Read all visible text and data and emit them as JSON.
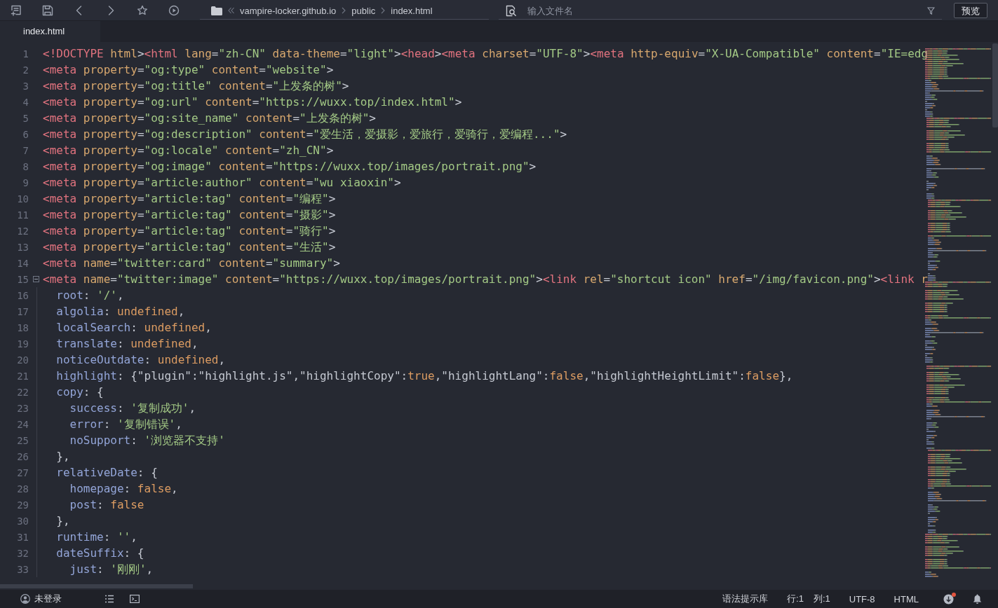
{
  "toolbar": {
    "breadcrumb": [
      "vampire-locker.github.io",
      "public",
      "index.html"
    ],
    "file_search": {
      "placeholder": "输入文件名"
    },
    "preview_button": "预览"
  },
  "tabs": [
    {
      "label": "index.html",
      "selected": true
    }
  ],
  "editor": {
    "lines": [
      {
        "number": "1",
        "fold": false,
        "tokens": [
          {
            "kind": "tag",
            "text": "<!DOCTYPE"
          },
          {
            "kind": "at",
            "text": " html"
          },
          {
            "kind": "p",
            "text": ">"
          },
          {
            "kind": "tag",
            "text": "<html"
          },
          {
            "kind": "at",
            "text": " lang"
          },
          {
            "kind": "p",
            "text": "="
          },
          {
            "kind": "s",
            "text": "\"zh-CN\""
          },
          {
            "kind": "at",
            "text": " data-theme"
          },
          {
            "kind": "p",
            "text": "="
          },
          {
            "kind": "s",
            "text": "\"light\""
          },
          {
            "kind": "p",
            "text": ">"
          },
          {
            "kind": "tag",
            "text": "<head"
          },
          {
            "kind": "p",
            "text": ">"
          },
          {
            "kind": "tag",
            "text": "<meta"
          },
          {
            "kind": "at",
            "text": " charset"
          },
          {
            "kind": "p",
            "text": "="
          },
          {
            "kind": "s",
            "text": "\"UTF-8\""
          },
          {
            "kind": "p",
            "text": ">"
          },
          {
            "kind": "tag",
            "text": "<meta"
          },
          {
            "kind": "at",
            "text": " http-equiv"
          },
          {
            "kind": "p",
            "text": "="
          },
          {
            "kind": "s",
            "text": "\"X-UA-Compatible\""
          },
          {
            "kind": "at",
            "text": " content"
          },
          {
            "kind": "p",
            "text": "="
          },
          {
            "kind": "s",
            "text": "\"IE=edg"
          }
        ]
      },
      {
        "number": "2",
        "fold": false,
        "tokens": [
          {
            "kind": "tag",
            "text": "<meta"
          },
          {
            "kind": "at",
            "text": " property"
          },
          {
            "kind": "p",
            "text": "="
          },
          {
            "kind": "s",
            "text": "\"og:type\""
          },
          {
            "kind": "at",
            "text": " content"
          },
          {
            "kind": "p",
            "text": "="
          },
          {
            "kind": "s",
            "text": "\"website\""
          },
          {
            "kind": "p",
            "text": ">"
          }
        ]
      },
      {
        "number": "3",
        "fold": false,
        "tokens": [
          {
            "kind": "tag",
            "text": "<meta"
          },
          {
            "kind": "at",
            "text": " property"
          },
          {
            "kind": "p",
            "text": "="
          },
          {
            "kind": "s",
            "text": "\"og:title\""
          },
          {
            "kind": "at",
            "text": " content"
          },
          {
            "kind": "p",
            "text": "="
          },
          {
            "kind": "s",
            "text": "\"上发条的树\""
          },
          {
            "kind": "p",
            "text": ">"
          }
        ]
      },
      {
        "number": "4",
        "fold": false,
        "tokens": [
          {
            "kind": "tag",
            "text": "<meta"
          },
          {
            "kind": "at",
            "text": " property"
          },
          {
            "kind": "p",
            "text": "="
          },
          {
            "kind": "s",
            "text": "\"og:url\""
          },
          {
            "kind": "at",
            "text": " content"
          },
          {
            "kind": "p",
            "text": "="
          },
          {
            "kind": "s",
            "text": "\"https://wuxx.top/index.html\""
          },
          {
            "kind": "p",
            "text": ">"
          }
        ]
      },
      {
        "number": "5",
        "fold": false,
        "tokens": [
          {
            "kind": "tag",
            "text": "<meta"
          },
          {
            "kind": "at",
            "text": " property"
          },
          {
            "kind": "p",
            "text": "="
          },
          {
            "kind": "s",
            "text": "\"og:site_name\""
          },
          {
            "kind": "at",
            "text": " content"
          },
          {
            "kind": "p",
            "text": "="
          },
          {
            "kind": "s",
            "text": "\"上发条的树\""
          },
          {
            "kind": "p",
            "text": ">"
          }
        ]
      },
      {
        "number": "6",
        "fold": false,
        "tokens": [
          {
            "kind": "tag",
            "text": "<meta"
          },
          {
            "kind": "at",
            "text": " property"
          },
          {
            "kind": "p",
            "text": "="
          },
          {
            "kind": "s",
            "text": "\"og:description\""
          },
          {
            "kind": "at",
            "text": " content"
          },
          {
            "kind": "p",
            "text": "="
          },
          {
            "kind": "s",
            "text": "\"爱生活，爱摄影，爱旅行，爱骑行，爱编程...\""
          },
          {
            "kind": "p",
            "text": ">"
          }
        ]
      },
      {
        "number": "7",
        "fold": false,
        "tokens": [
          {
            "kind": "tag",
            "text": "<meta"
          },
          {
            "kind": "at",
            "text": " property"
          },
          {
            "kind": "p",
            "text": "="
          },
          {
            "kind": "s",
            "text": "\"og:locale\""
          },
          {
            "kind": "at",
            "text": " content"
          },
          {
            "kind": "p",
            "text": "="
          },
          {
            "kind": "s",
            "text": "\"zh_CN\""
          },
          {
            "kind": "p",
            "text": ">"
          }
        ]
      },
      {
        "number": "8",
        "fold": false,
        "tokens": [
          {
            "kind": "tag",
            "text": "<meta"
          },
          {
            "kind": "at",
            "text": " property"
          },
          {
            "kind": "p",
            "text": "="
          },
          {
            "kind": "s",
            "text": "\"og:image\""
          },
          {
            "kind": "at",
            "text": " content"
          },
          {
            "kind": "p",
            "text": "="
          },
          {
            "kind": "s",
            "text": "\"https://wuxx.top/images/portrait.png\""
          },
          {
            "kind": "p",
            "text": ">"
          }
        ]
      },
      {
        "number": "9",
        "fold": false,
        "tokens": [
          {
            "kind": "tag",
            "text": "<meta"
          },
          {
            "kind": "at",
            "text": " property"
          },
          {
            "kind": "p",
            "text": "="
          },
          {
            "kind": "s",
            "text": "\"article:author\""
          },
          {
            "kind": "at",
            "text": " content"
          },
          {
            "kind": "p",
            "text": "="
          },
          {
            "kind": "s",
            "text": "\"wu xiaoxin\""
          },
          {
            "kind": "p",
            "text": ">"
          }
        ]
      },
      {
        "number": "10",
        "fold": false,
        "tokens": [
          {
            "kind": "tag",
            "text": "<meta"
          },
          {
            "kind": "at",
            "text": " property"
          },
          {
            "kind": "p",
            "text": "="
          },
          {
            "kind": "s",
            "text": "\"article:tag\""
          },
          {
            "kind": "at",
            "text": " content"
          },
          {
            "kind": "p",
            "text": "="
          },
          {
            "kind": "s",
            "text": "\"编程\""
          },
          {
            "kind": "p",
            "text": ">"
          }
        ]
      },
      {
        "number": "11",
        "fold": false,
        "tokens": [
          {
            "kind": "tag",
            "text": "<meta"
          },
          {
            "kind": "at",
            "text": " property"
          },
          {
            "kind": "p",
            "text": "="
          },
          {
            "kind": "s",
            "text": "\"article:tag\""
          },
          {
            "kind": "at",
            "text": " content"
          },
          {
            "kind": "p",
            "text": "="
          },
          {
            "kind": "s",
            "text": "\"摄影\""
          },
          {
            "kind": "p",
            "text": ">"
          }
        ]
      },
      {
        "number": "12",
        "fold": false,
        "tokens": [
          {
            "kind": "tag",
            "text": "<meta"
          },
          {
            "kind": "at",
            "text": " property"
          },
          {
            "kind": "p",
            "text": "="
          },
          {
            "kind": "s",
            "text": "\"article:tag\""
          },
          {
            "kind": "at",
            "text": " content"
          },
          {
            "kind": "p",
            "text": "="
          },
          {
            "kind": "s",
            "text": "\"骑行\""
          },
          {
            "kind": "p",
            "text": ">"
          }
        ]
      },
      {
        "number": "13",
        "fold": false,
        "tokens": [
          {
            "kind": "tag",
            "text": "<meta"
          },
          {
            "kind": "at",
            "text": " property"
          },
          {
            "kind": "p",
            "text": "="
          },
          {
            "kind": "s",
            "text": "\"article:tag\""
          },
          {
            "kind": "at",
            "text": " content"
          },
          {
            "kind": "p",
            "text": "="
          },
          {
            "kind": "s",
            "text": "\"生活\""
          },
          {
            "kind": "p",
            "text": ">"
          }
        ]
      },
      {
        "number": "14",
        "fold": false,
        "tokens": [
          {
            "kind": "tag",
            "text": "<meta"
          },
          {
            "kind": "at",
            "text": " name"
          },
          {
            "kind": "p",
            "text": "="
          },
          {
            "kind": "s",
            "text": "\"twitter:card\""
          },
          {
            "kind": "at",
            "text": " content"
          },
          {
            "kind": "p",
            "text": "="
          },
          {
            "kind": "s",
            "text": "\"summary\""
          },
          {
            "kind": "p",
            "text": ">"
          }
        ]
      },
      {
        "number": "15",
        "fold": true,
        "tokens": [
          {
            "kind": "tag",
            "text": "<meta"
          },
          {
            "kind": "at",
            "text": " name"
          },
          {
            "kind": "p",
            "text": "="
          },
          {
            "kind": "s",
            "text": "\"twitter:image\""
          },
          {
            "kind": "at",
            "text": " content"
          },
          {
            "kind": "p",
            "text": "="
          },
          {
            "kind": "s",
            "text": "\"https://wuxx.top/images/portrait.png\""
          },
          {
            "kind": "p",
            "text": ">"
          },
          {
            "kind": "tag",
            "text": "<link"
          },
          {
            "kind": "at",
            "text": " rel"
          },
          {
            "kind": "p",
            "text": "="
          },
          {
            "kind": "s",
            "text": "\"shortcut icon\""
          },
          {
            "kind": "at",
            "text": " href"
          },
          {
            "kind": "p",
            "text": "="
          },
          {
            "kind": "s",
            "text": "\"/img/favicon.png\""
          },
          {
            "kind": "p",
            "text": ">"
          },
          {
            "kind": "tag",
            "text": "<link"
          },
          {
            "kind": "at",
            "text": " r"
          }
        ]
      },
      {
        "number": "16",
        "fold": false,
        "tokens": [
          {
            "kind": "key",
            "text": "  root"
          },
          {
            "kind": "p",
            "text": ": "
          },
          {
            "kind": "s",
            "text": "'/'"
          },
          {
            "kind": "p",
            "text": ","
          }
        ]
      },
      {
        "number": "17",
        "fold": false,
        "tokens": [
          {
            "kind": "key",
            "text": "  algolia"
          },
          {
            "kind": "p",
            "text": ": "
          },
          {
            "kind": "kw",
            "text": "undefined"
          },
          {
            "kind": "p",
            "text": ","
          }
        ]
      },
      {
        "number": "18",
        "fold": false,
        "tokens": [
          {
            "kind": "key",
            "text": "  localSearch"
          },
          {
            "kind": "p",
            "text": ": "
          },
          {
            "kind": "kw",
            "text": "undefined"
          },
          {
            "kind": "p",
            "text": ","
          }
        ]
      },
      {
        "number": "19",
        "fold": false,
        "tokens": [
          {
            "kind": "key",
            "text": "  translate"
          },
          {
            "kind": "p",
            "text": ": "
          },
          {
            "kind": "kw",
            "text": "undefined"
          },
          {
            "kind": "p",
            "text": ","
          }
        ]
      },
      {
        "number": "20",
        "fold": false,
        "tokens": [
          {
            "kind": "key",
            "text": "  noticeOutdate"
          },
          {
            "kind": "p",
            "text": ": "
          },
          {
            "kind": "kw",
            "text": "undefined"
          },
          {
            "kind": "p",
            "text": ","
          }
        ]
      },
      {
        "number": "21",
        "fold": false,
        "tokens": [
          {
            "kind": "key",
            "text": "  highlight"
          },
          {
            "kind": "p",
            "text": ": {\"plugin\":\"highlight.js\",\"highlightCopy\":"
          },
          {
            "kind": "kw",
            "text": "true"
          },
          {
            "kind": "p",
            "text": ",\"highlightLang\":"
          },
          {
            "kind": "kw",
            "text": "false"
          },
          {
            "kind": "p",
            "text": ",\"highlightHeightLimit\":"
          },
          {
            "kind": "kw",
            "text": "false"
          },
          {
            "kind": "p",
            "text": "},"
          }
        ]
      },
      {
        "number": "22",
        "fold": false,
        "tokens": [
          {
            "kind": "key",
            "text": "  copy"
          },
          {
            "kind": "p",
            "text": ": {"
          }
        ]
      },
      {
        "number": "23",
        "fold": false,
        "tokens": [
          {
            "kind": "key",
            "text": "    success"
          },
          {
            "kind": "p",
            "text": ": "
          },
          {
            "kind": "s",
            "text": "'复制成功'"
          },
          {
            "kind": "p",
            "text": ","
          }
        ]
      },
      {
        "number": "24",
        "fold": false,
        "tokens": [
          {
            "kind": "key",
            "text": "    error"
          },
          {
            "kind": "p",
            "text": ": "
          },
          {
            "kind": "s",
            "text": "'复制错误'"
          },
          {
            "kind": "p",
            "text": ","
          }
        ]
      },
      {
        "number": "25",
        "fold": false,
        "tokens": [
          {
            "kind": "key",
            "text": "    noSupport"
          },
          {
            "kind": "p",
            "text": ": "
          },
          {
            "kind": "s",
            "text": "'浏览器不支持'"
          }
        ]
      },
      {
        "number": "26",
        "fold": false,
        "tokens": [
          {
            "kind": "p",
            "text": "  },"
          }
        ]
      },
      {
        "number": "27",
        "fold": false,
        "tokens": [
          {
            "kind": "key",
            "text": "  relativeDate"
          },
          {
            "kind": "p",
            "text": ": {"
          }
        ]
      },
      {
        "number": "28",
        "fold": false,
        "tokens": [
          {
            "kind": "key",
            "text": "    homepage"
          },
          {
            "kind": "p",
            "text": ": "
          },
          {
            "kind": "kw",
            "text": "false"
          },
          {
            "kind": "p",
            "text": ","
          }
        ]
      },
      {
        "number": "29",
        "fold": false,
        "tokens": [
          {
            "kind": "key",
            "text": "    post"
          },
          {
            "kind": "p",
            "text": ": "
          },
          {
            "kind": "kw",
            "text": "false"
          }
        ]
      },
      {
        "number": "30",
        "fold": false,
        "tokens": [
          {
            "kind": "p",
            "text": "  },"
          }
        ]
      },
      {
        "number": "31",
        "fold": false,
        "tokens": [
          {
            "kind": "key",
            "text": "  runtime"
          },
          {
            "kind": "p",
            "text": ": "
          },
          {
            "kind": "s",
            "text": "''"
          },
          {
            "kind": "p",
            "text": ","
          }
        ]
      },
      {
        "number": "32",
        "fold": false,
        "tokens": [
          {
            "kind": "key",
            "text": "  dateSuffix"
          },
          {
            "kind": "p",
            "text": ": {"
          }
        ]
      },
      {
        "number": "33",
        "fold": false,
        "tokens": [
          {
            "kind": "key",
            "text": "    just"
          },
          {
            "kind": "p",
            "text": ": "
          },
          {
            "kind": "s",
            "text": "'刚刚'"
          },
          {
            "kind": "p",
            "text": ","
          }
        ]
      }
    ]
  },
  "status_bar": {
    "user": "未登录",
    "syntax_library": "语法提示库",
    "line": "行:1",
    "column": "列:1",
    "encoding": "UTF-8",
    "language": "HTML",
    "update_badge": true
  }
}
